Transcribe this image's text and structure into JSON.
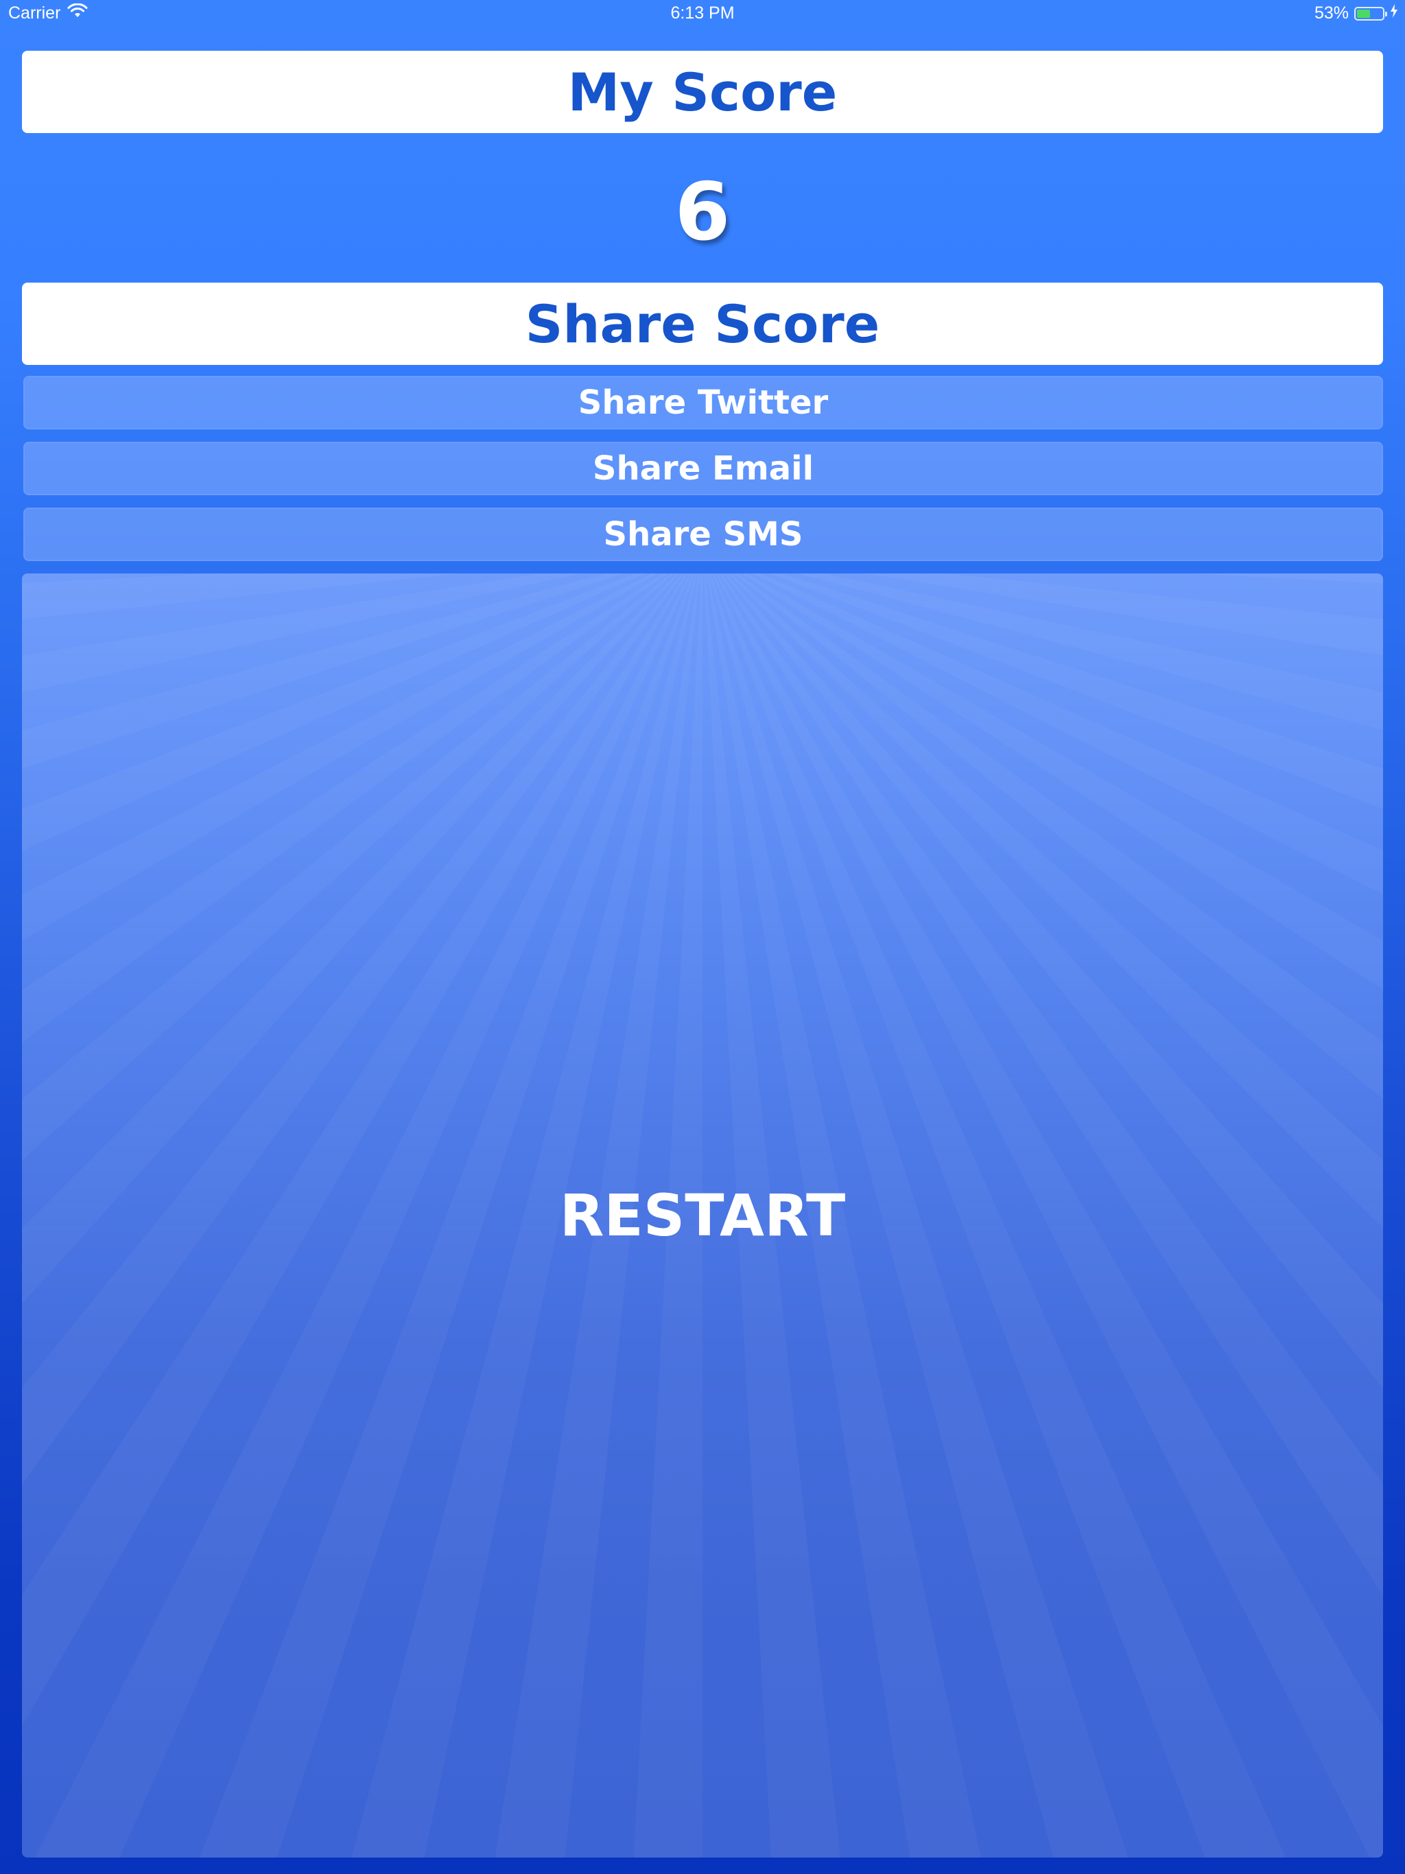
{
  "status_bar": {
    "carrier": "Carrier",
    "time": "6:13 PM",
    "battery_percent": "53%",
    "battery_level": 0.53,
    "wifi_icon": "wifi-icon",
    "charging_icon": "charging-bolt-icon"
  },
  "header": {
    "title": "My Score"
  },
  "score": {
    "value": "6"
  },
  "share": {
    "title": "Share Score",
    "twitter_label": "Share Twitter",
    "email_label": "Share Email",
    "sms_label": "Share SMS"
  },
  "restart": {
    "label": "RESTART"
  },
  "colors": {
    "accent_text": "#1655cc",
    "background_top": "#3a83ff",
    "background_bottom": "#0733bd",
    "battery_fill": "#4cd964"
  }
}
